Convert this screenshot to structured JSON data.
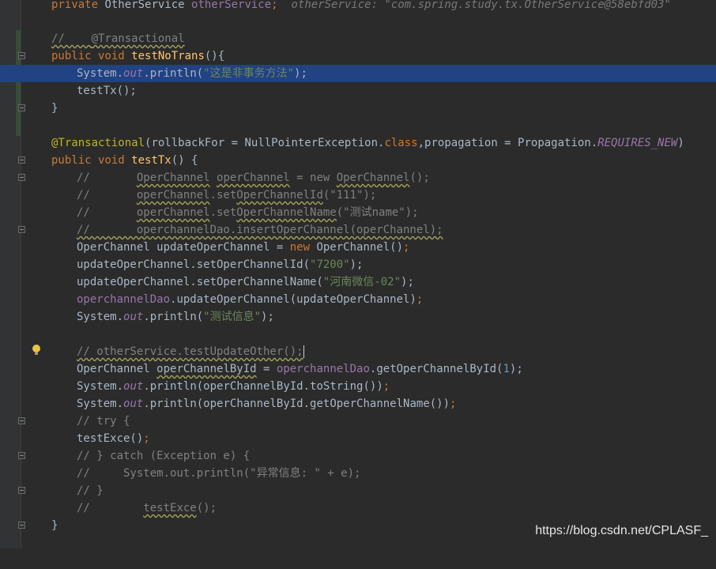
{
  "lines": {
    "l0": {
      "kw": "private ",
      "type": "OtherService ",
      "field": "otherService",
      "semi": ";",
      "hint": "  otherService: \"com.spring.study.tx.OtherService@58ebfd03\""
    },
    "l2": {
      "prefix": "//    ",
      "ann": "@Transactional"
    },
    "l3": {
      "kw": "public void ",
      "fn": "testNoTrans",
      "rest": "(){"
    },
    "l4": {
      "a": "System.",
      "out": "out",
      "b": ".println(",
      "str": "\"这是非事务方法\"",
      "c": ");"
    },
    "l5": {
      "text": "testTx();"
    },
    "l6": {
      "text": "}"
    },
    "l8": {
      "ann": "@Transactional",
      "a": "(rollbackFor = NullPointerException.",
      "kw": "class",
      "b": ",propagation = Propagation.",
      "fld": "REQUIRES_NEW",
      "c": ")"
    },
    "l9": {
      "kw": "public void ",
      "fn": "testTx",
      "rest": "() {"
    },
    "l10": {
      "pre": "//       ",
      "w1": "OperChannel",
      "s1": " ",
      "w2": "operChannel",
      "s2": " = new ",
      "w3": "OperChannel",
      "s3": "();"
    },
    "l11": {
      "pre": "//       ",
      "w1": "operChannel",
      "s1": ".set",
      "w2": "OperChannelId",
      "s2": "(\"111\");"
    },
    "l12": {
      "pre": "//       ",
      "w1": "operChannel",
      "s1": ".set",
      "w2": "OperChannelName",
      "s2": "(\"测试name\");"
    },
    "l13": {
      "text": "//       operchannelDao.insertOperChannel(operChannel);"
    },
    "l14": {
      "a": "OperChannel updateOperChannel = ",
      "kw": "new ",
      "b": "OperChannel()",
      "c": ";"
    },
    "l15": {
      "a": "updateOperChannel.setOperChannelId(",
      "str": "\"7200\"",
      "b": ");"
    },
    "l16": {
      "a": "updateOperChannel.setOperChannelName(",
      "str": "\"河南微信-02\"",
      "b": ");"
    },
    "l17": {
      "fld": "operchannelDao",
      "a": ".updateOperChannel(updateOperChannel)",
      "b": ";"
    },
    "l18": {
      "a": "System.",
      "out": "out",
      "b": ".println(",
      "str": "\"测试信息\"",
      "c": ");"
    },
    "l20": {
      "text": "// otherService.testUpdateOther();"
    },
    "l21": {
      "a": "OperChannel ",
      "b": "operChannelById",
      "c": " = ",
      "fld": "operchannelDao",
      "d": ".getOperChannelById(",
      "num": "1",
      "e": ");"
    },
    "l22": {
      "a": "System.",
      "out": "out",
      "b": ".println(operChannelById.toString())",
      "c": ";"
    },
    "l23": {
      "a": "System.",
      "out": "out",
      "b": ".println(operChannelById.getOperChannelName())",
      "c": ";"
    },
    "l24": {
      "text": "// try {"
    },
    "l25": {
      "text": "testExce()",
      "semi": ";"
    },
    "l26": {
      "text": "// } catch (Exception e) {"
    },
    "l27": {
      "text": "//     System.out.println(\"异常信息: \" + e);"
    },
    "l28": {
      "text": "// }"
    },
    "l29": {
      "pre": "//        ",
      "w": "testExce",
      "post": "();"
    },
    "l30": {
      "text": "}"
    }
  },
  "watermark": "https://blog.csdn.net/CPLASF_",
  "colors": {
    "background": "#2b2b2b",
    "keyword": "#cc7832",
    "annotation": "#bbb529",
    "string": "#6a8759",
    "method": "#ffc66d",
    "field": "#9876aa",
    "comment": "#808080",
    "selection": "#214283"
  }
}
